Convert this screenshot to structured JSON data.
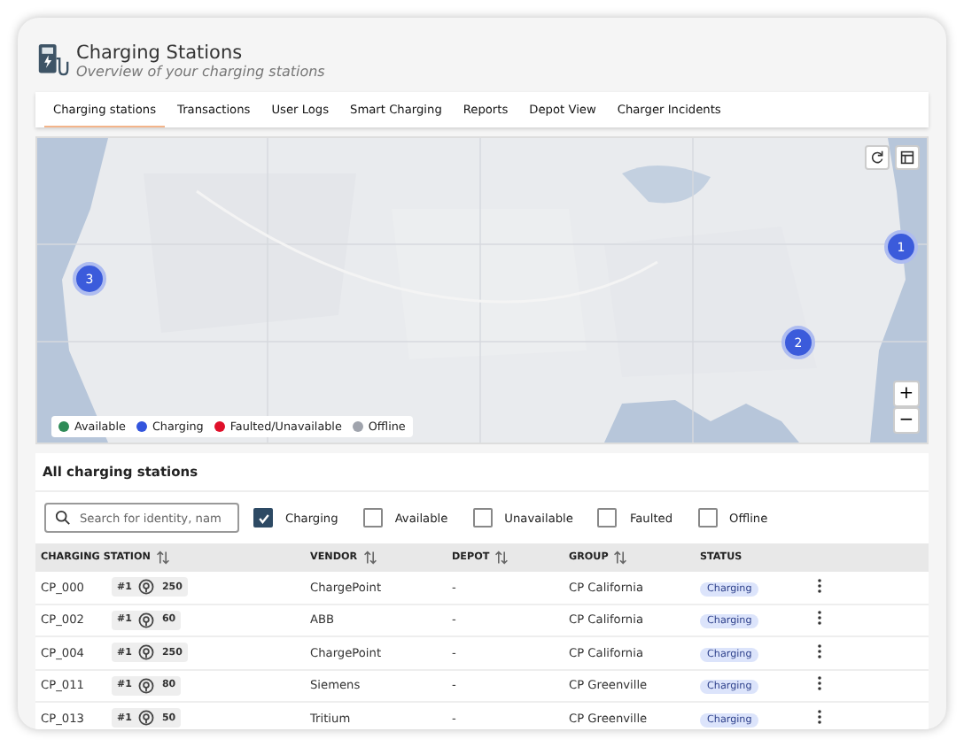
{
  "header": {
    "title": "Charging Stations",
    "subtitle": "Overview of your charging stations"
  },
  "tabs": [
    {
      "label": "Charging stations",
      "selected": true
    },
    {
      "label": "Transactions",
      "selected": false
    },
    {
      "label": "User Logs",
      "selected": false
    },
    {
      "label": "Smart Charging",
      "selected": false
    },
    {
      "label": "Reports",
      "selected": false
    },
    {
      "label": "Depot View",
      "selected": false
    },
    {
      "label": "Charger Incidents",
      "selected": false
    }
  ],
  "map": {
    "clusters": [
      {
        "count": "3",
        "color": "#3b5bdb"
      },
      {
        "count": "2",
        "color": "#3b5bdb"
      },
      {
        "count": "1",
        "color": "#3b5bdb"
      }
    ],
    "legend": [
      {
        "label": "Available",
        "color": "#2e8b57"
      },
      {
        "label": "Charging",
        "color": "#3355dd"
      },
      {
        "label": "Faulted/Unavailable",
        "color": "#e0102a"
      },
      {
        "label": "Offline",
        "color": "#a0a4ad"
      }
    ],
    "zoom_in": "+",
    "zoom_out": "−"
  },
  "list": {
    "title": "All charging stations",
    "search": {
      "placeholder": "Search for identity, nam"
    },
    "filters": [
      {
        "label": "Charging",
        "checked": true
      },
      {
        "label": "Available",
        "checked": false
      },
      {
        "label": "Unavailable",
        "checked": false
      },
      {
        "label": "Faulted",
        "checked": false
      },
      {
        "label": "Offline",
        "checked": false
      }
    ],
    "columns": [
      {
        "label": "CHARGING STATION",
        "sortable": true
      },
      {
        "label": "VENDOR",
        "sortable": true
      },
      {
        "label": "DEPOT",
        "sortable": true
      },
      {
        "label": "GROUP",
        "sortable": true
      },
      {
        "label": "STATUS",
        "sortable": false
      }
    ],
    "rows": [
      {
        "station": "CP_000",
        "connector": "#1",
        "power": "250",
        "vendor": "ChargePoint",
        "depot": "-",
        "group": "CP California",
        "status": "Charging"
      },
      {
        "station": "CP_002",
        "connector": "#1",
        "power": "60",
        "vendor": "ABB",
        "depot": "-",
        "group": "CP California",
        "status": "Charging"
      },
      {
        "station": "CP_004",
        "connector": "#1",
        "power": "250",
        "vendor": "ChargePoint",
        "depot": "-",
        "group": "CP California",
        "status": "Charging"
      },
      {
        "station": "CP_011",
        "connector": "#1",
        "power": "80",
        "vendor": "Siemens",
        "depot": "-",
        "group": "CP Greenville",
        "status": "Charging"
      },
      {
        "station": "CP_013",
        "connector": "#1",
        "power": "50",
        "vendor": "Tritium",
        "depot": "-",
        "group": "CP Greenville",
        "status": "Charging"
      }
    ]
  }
}
